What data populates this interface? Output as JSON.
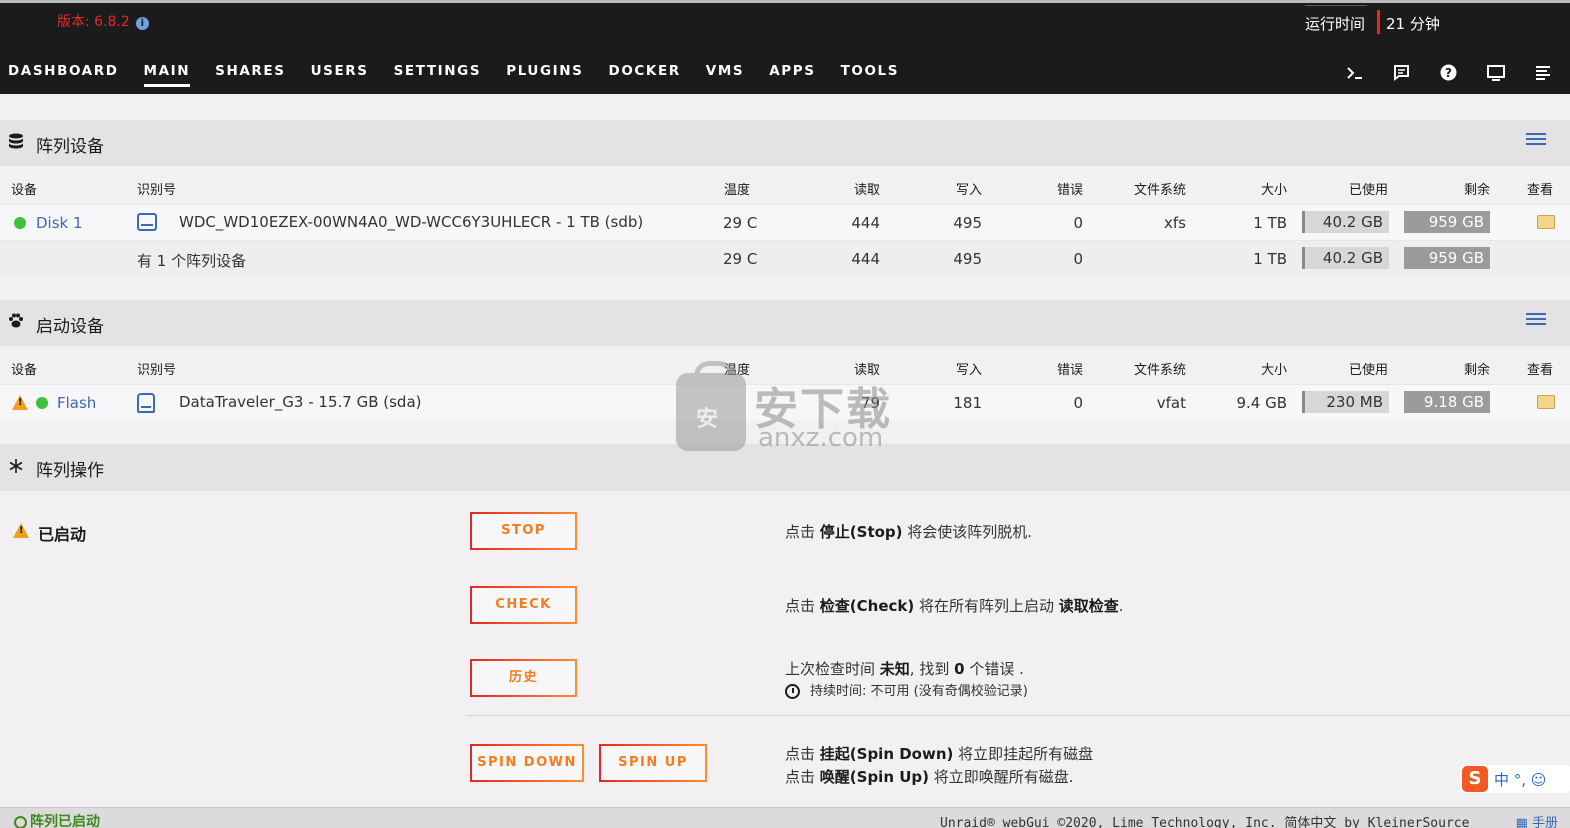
{
  "header": {
    "version": "版本: 6.8.2",
    "uptime_label": "运行时间",
    "uptime_value": "21 分钟"
  },
  "nav": [
    "DASHBOARD",
    "MAIN",
    "SHARES",
    "USERS",
    "SETTINGS",
    "PLUGINS",
    "DOCKER",
    "VMS",
    "APPS",
    "TOOLS"
  ],
  "nav_active": "MAIN",
  "nav_icons": [
    "terminal-icon",
    "feedback-icon",
    "help-icon",
    "monitor-icon",
    "log-icon"
  ],
  "columns": {
    "device": "设备",
    "identification": "识别号",
    "temp": "温度",
    "reads": "读取",
    "writes": "写入",
    "errors": "错误",
    "fs": "文件系统",
    "size": "大小",
    "used": "已使用",
    "free": "剩余",
    "view": "查看"
  },
  "array": {
    "title": "阵列设备",
    "disk": {
      "name": "Disk 1",
      "id": "WDC_WD10EZEX-00WN4A0_WD-WCC6Y3UHLECR - 1 TB (sdb)",
      "temp": "29 C",
      "reads": "444",
      "writes": "495",
      "errors": "0",
      "fs": "xfs",
      "size": "1 TB",
      "used": "40.2 GB",
      "free": "959 GB"
    },
    "summary": {
      "label": "有 1 个阵列设备",
      "temp": "29 C",
      "reads": "444",
      "writes": "495",
      "errors": "0",
      "size": "1 TB",
      "used": "40.2 GB",
      "free": "959 GB"
    }
  },
  "boot": {
    "title": "启动设备",
    "disk": {
      "name": "Flash",
      "id": "DataTraveler_G3 - 15.7 GB (sda)",
      "reads": "79",
      "writes": "181",
      "errors": "0",
      "fs": "vfat",
      "size": "9.4 GB",
      "used": "230 MB",
      "free": "9.18 GB"
    }
  },
  "ops": {
    "title": "阵列操作",
    "status": "已启动",
    "stop_label": "STOP",
    "check_label": "CHECK",
    "history_label": "历史",
    "spindown_label": "SPIN DOWN",
    "spinup_label": "SPIN UP",
    "stop_desc_pre": "点击 ",
    "stop_desc_bold": "停止(Stop)",
    "stop_desc_post": " 将会使该阵列脱机.",
    "check_desc_pre": "点击 ",
    "check_desc_bold": "检查(Check)",
    "check_desc_mid": " 将在所有阵列上启动 ",
    "check_desc_bold2": "读取检查",
    "check_desc_post": ".",
    "history_desc_pre": "上次检查时间 ",
    "history_desc_bold": "未知",
    "history_desc_mid": ", 找到 ",
    "history_desc_bold2": "0",
    "history_desc_post": " 个错误 .",
    "duration": "持续时间: 不可用 (没有奇偶校验记录)",
    "spindown_desc_pre": "点击 ",
    "spindown_desc_bold": "挂起(Spin Down)",
    "spindown_desc_post": " 将立即挂起所有磁盘",
    "spinup_desc_pre": "点击 ",
    "spinup_desc_bold": "唤醒(Spin Up)",
    "spinup_desc_post": " 将立即唤醒所有磁盘."
  },
  "footer": {
    "status": "阵列已启动",
    "copyright": "Unraid® webGui ©2020, Lime Technology, Inc. 简体中文 by KleinerSource",
    "manual": "手册"
  },
  "watermark": {
    "badge": "安",
    "text": "安下载",
    "domain": "anxz.com"
  },
  "ime": {
    "logo": "S",
    "text": "中 °, ☺"
  },
  "colors": {
    "header_bg": "#1c1b1b",
    "version_red": "#e22828",
    "link_blue": "#3b6ab4",
    "status_green": "#3cc23c",
    "button_orange": "#f57c1f",
    "warning": "#f0a020"
  }
}
